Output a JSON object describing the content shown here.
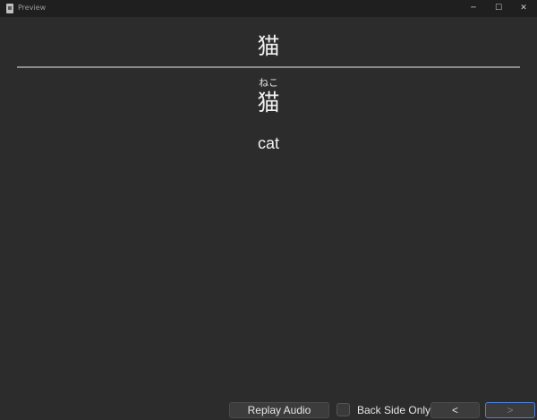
{
  "window": {
    "title": "Preview",
    "minimize_glyph": "─",
    "maximize_glyph": "☐",
    "close_glyph": "✕"
  },
  "card": {
    "front": "猫",
    "reading": "ねこ",
    "back_word": "猫",
    "meaning": "cat"
  },
  "controls": {
    "replay_label": "Replay Audio",
    "back_side_only_label": "Back Side Only",
    "back_side_only_checked": false,
    "prev_label": "<",
    "next_label": ">"
  },
  "colors": {
    "background": "#2c2c2c",
    "titlebar": "#1f1f1f",
    "divider": "#8a8a8a",
    "next_focus_border": "#4a7fd4"
  }
}
